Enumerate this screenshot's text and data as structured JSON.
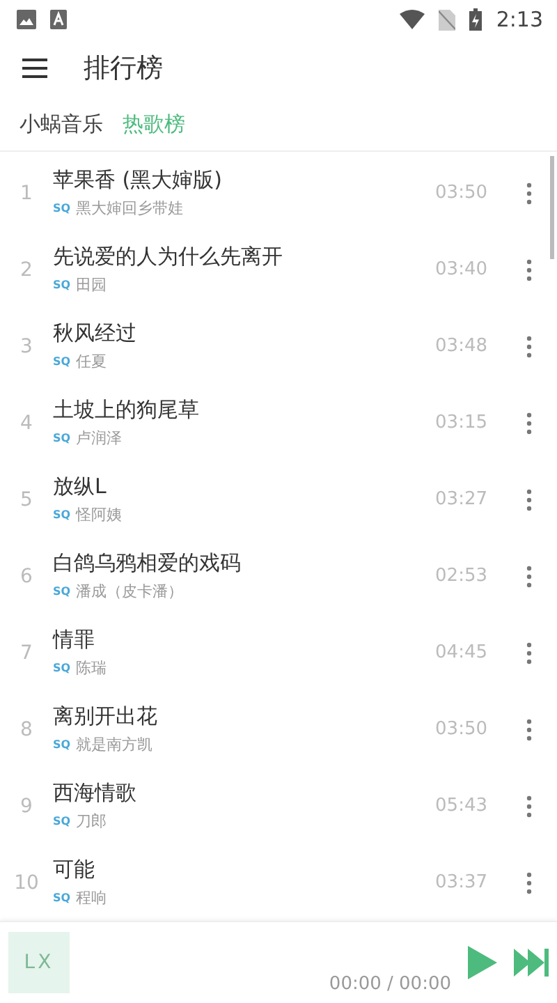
{
  "status_bar": {
    "time": "2:13"
  },
  "toolbar": {
    "title": "排行榜"
  },
  "tabs": [
    {
      "label": "小蜗音乐",
      "selected": false
    },
    {
      "label": "热歌榜",
      "selected": true
    }
  ],
  "songs": [
    {
      "index": "1",
      "title": "苹果香 (黑大婶版)",
      "quality": "SQ",
      "artist": "黑大婶回乡带娃",
      "duration": "03:50"
    },
    {
      "index": "2",
      "title": "先说爱的人为什么先离开",
      "quality": "SQ",
      "artist": "田园",
      "duration": "03:40"
    },
    {
      "index": "3",
      "title": "秋风经过",
      "quality": "SQ",
      "artist": "任夏",
      "duration": "03:48"
    },
    {
      "index": "4",
      "title": "土坡上的狗尾草",
      "quality": "SQ",
      "artist": "卢润泽",
      "duration": "03:15"
    },
    {
      "index": "5",
      "title": "放纵L",
      "quality": "SQ",
      "artist": "怪阿姨",
      "duration": "03:27"
    },
    {
      "index": "6",
      "title": "白鸽乌鸦相爱的戏码",
      "quality": "SQ",
      "artist": "潘成（皮卡潘）",
      "duration": "02:53"
    },
    {
      "index": "7",
      "title": "情罪",
      "quality": "SQ",
      "artist": "陈瑞",
      "duration": "04:45"
    },
    {
      "index": "8",
      "title": "离别开出花",
      "quality": "SQ",
      "artist": "就是南方凯",
      "duration": "03:50"
    },
    {
      "index": "9",
      "title": "西海情歌",
      "quality": "SQ",
      "artist": "刀郎",
      "duration": "05:43"
    },
    {
      "index": "10",
      "title": "可能",
      "quality": "SQ",
      "artist": "程响",
      "duration": "03:37"
    }
  ],
  "player": {
    "cover_text": "LX",
    "time": "00:00 / 00:00"
  }
}
